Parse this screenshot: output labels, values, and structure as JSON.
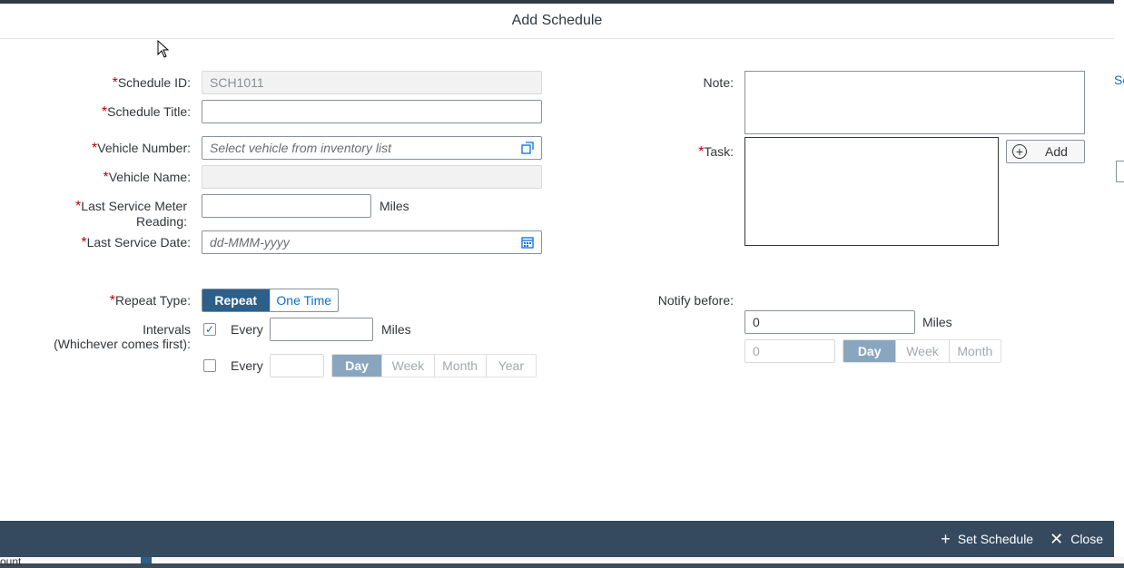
{
  "background": {
    "right_fragment": "Sc",
    "bottom_fragment": "ount"
  },
  "dialog": {
    "title": "Add Schedule"
  },
  "form": {
    "schedule_id": {
      "label": "Schedule ID:",
      "value": "SCH1011"
    },
    "schedule_title": {
      "label": "Schedule Title:",
      "value": ""
    },
    "vehicle_number": {
      "label": "Vehicle Number:",
      "placeholder": "Select vehicle from inventory list",
      "icon": "value-help-icon"
    },
    "vehicle_name": {
      "label": "Vehicle Name:",
      "value": ""
    },
    "last_service_meter": {
      "label_line1": "Last Service Meter",
      "label_line2": "Reading:",
      "value": "",
      "unit": "Miles"
    },
    "last_service_date": {
      "label": "Last Service Date:",
      "placeholder": "dd-MMM-yyyy",
      "icon": "calendar-icon"
    },
    "repeat_type": {
      "label": "Repeat Type:",
      "options": [
        "Repeat",
        "One Time"
      ],
      "selected": "Repeat"
    },
    "intervals": {
      "label_line1": "Intervals",
      "label_line2": "(Whichever comes first):",
      "row1": {
        "checked": true,
        "every_label": "Every",
        "value": "",
        "unit": "Miles"
      },
      "row2": {
        "checked": false,
        "every_label": "Every",
        "value": "",
        "options": [
          "Day",
          "Week",
          "Month",
          "Year"
        ],
        "selected": "Day"
      }
    },
    "note": {
      "label": "Note:"
    },
    "task": {
      "label": "Task:",
      "add_label": "Add"
    },
    "notify_before": {
      "label": "Notify before:",
      "miles_value": "0",
      "miles_unit": "Miles",
      "period_value": "0",
      "options": [
        "Day",
        "Week",
        "Month"
      ],
      "selected": "Day"
    }
  },
  "footer": {
    "set_schedule_label": "Set Schedule",
    "close_label": "Close"
  },
  "colors": {
    "footer_bg": "#354a5f",
    "accent": "#2c5f8a",
    "required": "#bb0000"
  }
}
